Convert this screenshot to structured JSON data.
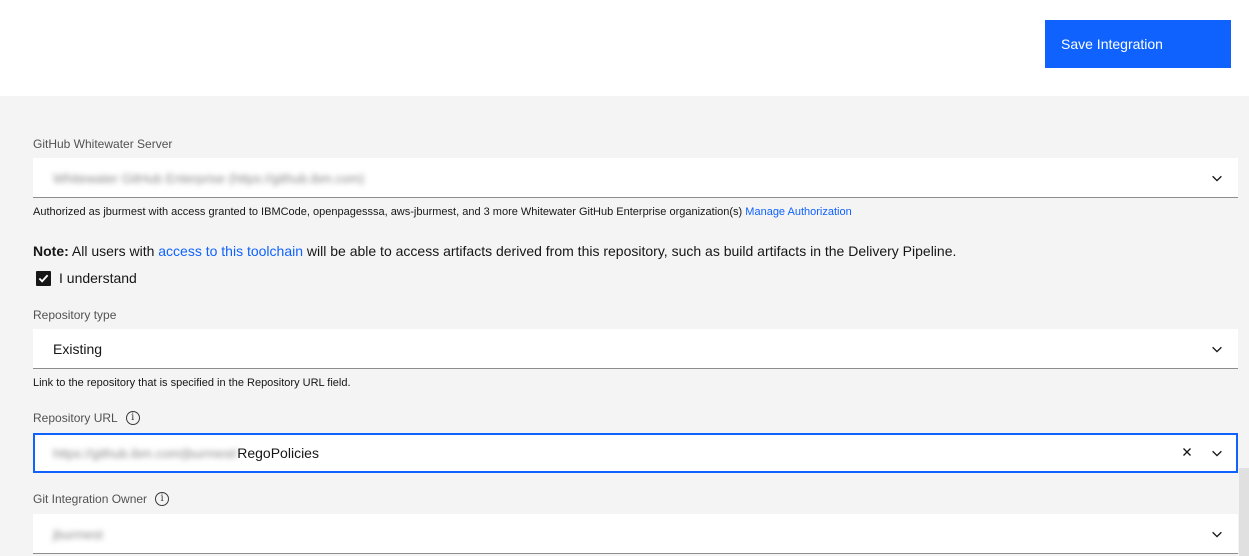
{
  "header": {
    "save_label": "Save Integration"
  },
  "server": {
    "label": "GitHub Whitewater Server",
    "value": "Whitewater GitHub Enterprise (https://github.ibm.com)",
    "helper_text": "Authorized as jburmest with access granted to IBMCode, openpagesssa, aws-jburmest, and 3 more Whitewater GitHub Enterprise organization(s)",
    "helper_link": "Manage Authorization"
  },
  "note": {
    "prefix": "Note:",
    "text_before": "All users with",
    "link": "access to this toolchain",
    "text_after": "will be able to access artifacts derived from this repository, such as build artifacts in the Delivery Pipeline."
  },
  "understand": {
    "label": "I understand",
    "checked": true
  },
  "repo_type": {
    "label": "Repository type",
    "value": "Existing",
    "helper_text": "Link to the repository that is specified in the Repository URL field."
  },
  "repo_url": {
    "label": "Repository URL",
    "value_prefix": "https://github.ibm.com/jburmest/",
    "value": "RegoPolicies"
  },
  "git_owner": {
    "label": "Git Integration Owner",
    "value": "jburmest"
  },
  "icons": {
    "info": "info-icon",
    "chevron": "chevron-down-icon",
    "clear": "close-icon",
    "check": "checkmark-icon"
  },
  "colors": {
    "accent": "#0f62fe",
    "background": "#f4f4f4"
  }
}
